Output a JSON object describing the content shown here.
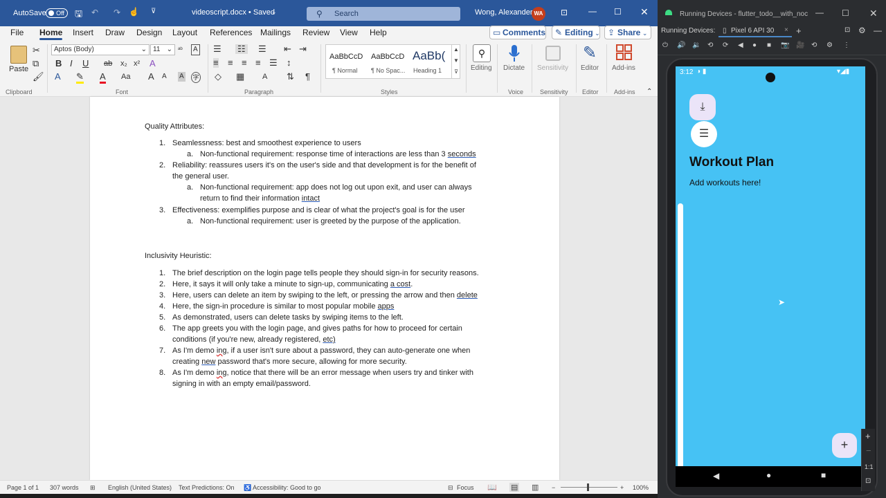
{
  "word": {
    "autosave_label": "AutoSave",
    "autosave_state": "Off",
    "doc_title": "videoscript.docx • Saved",
    "search_placeholder": "Search",
    "user_name": "Wong, Alexander",
    "user_initials": "WA",
    "menu": [
      "File",
      "Home",
      "Insert",
      "Draw",
      "Design",
      "Layout",
      "References",
      "Mailings",
      "Review",
      "View",
      "Help"
    ],
    "comments_label": "Comments",
    "editing_label": "Editing",
    "share_label": "Share",
    "ribbon": {
      "paste": "Paste",
      "clipboard": "Clipboard",
      "font_name": "Aptos (Body)",
      "font_size": "11",
      "font_group": "Font",
      "paragraph_group": "Paragraph",
      "styles_group": "Styles",
      "styles": [
        {
          "preview": "AaBbCcD",
          "label": "¶ Normal"
        },
        {
          "preview": "AaBbCcD",
          "label": "¶ No Spac..."
        },
        {
          "preview": "AaBb(",
          "label": "Heading 1"
        }
      ],
      "editing": "Editing",
      "dictate": "Dictate",
      "voice": "Voice",
      "sensitivity": "Sensitivity",
      "editor": "Editor",
      "addins": "Add-ins"
    },
    "document": {
      "heading1": "Quality Attributes:",
      "qa_items": [
        {
          "num": "1.",
          "text": "Seamlessness:  best and smoothest experience to users"
        },
        {
          "num": "a.",
          "text": "Non-functional requirement: response time of interactions are less than 3 ",
          "link": "seconds"
        },
        {
          "num": "2.",
          "text": "Reliability: reassures users it's on the user's side and that development  is for the benefit of"
        },
        {
          "num": "",
          "text": "the general user."
        },
        {
          "num": "a.",
          "text": "Non-functional  requirement:  app does not log out upon exit, and user can always"
        },
        {
          "num": "",
          "text": "return to find their information ",
          "link": "intact"
        },
        {
          "num": "3.",
          "text": "Effectiveness:  exemplifies purpose and is clear of what the project's goal is for the user"
        },
        {
          "num": "a.",
          "text": "Non-functional  requirement:  user is greeted by the purpose of the application."
        }
      ],
      "heading2": "Inclusivity Heuristic:",
      "ih_items": [
        {
          "num": "1.",
          "text": "The brief description  on the login page tells people they should sign-in for security reasons."
        },
        {
          "num": "2.",
          "text": "Here, it says it will only take a minute to sign-up, communicating ",
          "link": "a cost",
          "tail": "."
        },
        {
          "num": "3.",
          "text": "Here, users can delete an item by swiping to the left, or pressing the arrow and then ",
          "link": "delete"
        },
        {
          "num": "4.",
          "text": "Here, the sign-in procedure is similar to most popular mobile ",
          "link": "apps"
        },
        {
          "num": "5.",
          "text": "As demonstrated,  users can delete tasks by swiping items to the left."
        },
        {
          "num": "6.",
          "text": "The app greets you with the login page, and gives paths for how to proceed for certain"
        },
        {
          "num": "",
          "text": "conditions (if you're new, already registered, ",
          "link": "etc)"
        },
        {
          "num": "7.",
          "text": "As I'm demo  ",
          "wavy": "ing",
          "text2": ", if a user isn't sure about a password, they can auto-generate one when"
        },
        {
          "num": "",
          "text": "creating ",
          "link": "new",
          "tail": " password that's more secure, allowing for more security."
        },
        {
          "num": "8.",
          "text": "As I'm demo  ",
          "wavy": "ing",
          "text2": ", notice that there will be an error message when users try and tinker with"
        },
        {
          "num": "",
          "text": "signing in with an empty email/password."
        }
      ]
    },
    "status": {
      "page": "Page 1 of 1",
      "words": "307 words",
      "language": "English (United States)",
      "predictions": "Text Predictions: On",
      "accessibility": "Accessibility: Good to go",
      "focus": "Focus",
      "zoom": "100%"
    }
  },
  "studio": {
    "window_title": "Running Devices - flutter_todo__with_noc",
    "running_label": "Running Devices:",
    "device_tab": "Pixel 6 API 30",
    "phone": {
      "time": "3:12",
      "title": "Workout Plan",
      "subtitle": "Add workouts here!",
      "fab": "+",
      "zoom_ratio": "1:1"
    }
  },
  "colors": {
    "word_blue": "#2b579a",
    "phone_bg": "#46c2f4",
    "fab_bg": "#ebe4f8"
  }
}
